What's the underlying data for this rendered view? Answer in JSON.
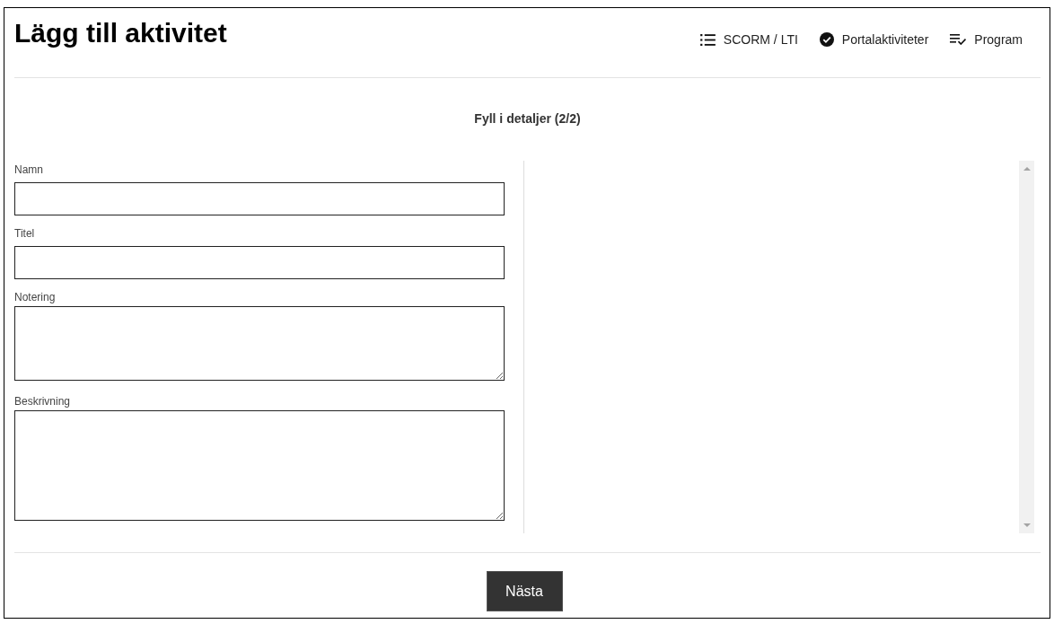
{
  "title": "Lägg till aktivitet",
  "nav": [
    {
      "kind": "list",
      "label": "SCORM / LTI"
    },
    {
      "kind": "check",
      "label": "Portalaktiviteter"
    },
    {
      "kind": "checklist",
      "label": "Program"
    }
  ],
  "step_title": "Fyll i detaljer (2/2)",
  "fields": [
    {
      "kind": "input",
      "label": "Namn"
    },
    {
      "kind": "input",
      "label": "Titel"
    },
    {
      "kind": "textarea",
      "label": "Notering"
    },
    {
      "kind": "textarea",
      "label": "Beskrivning"
    }
  ],
  "buttons": [
    {
      "label": "Nästa"
    }
  ]
}
